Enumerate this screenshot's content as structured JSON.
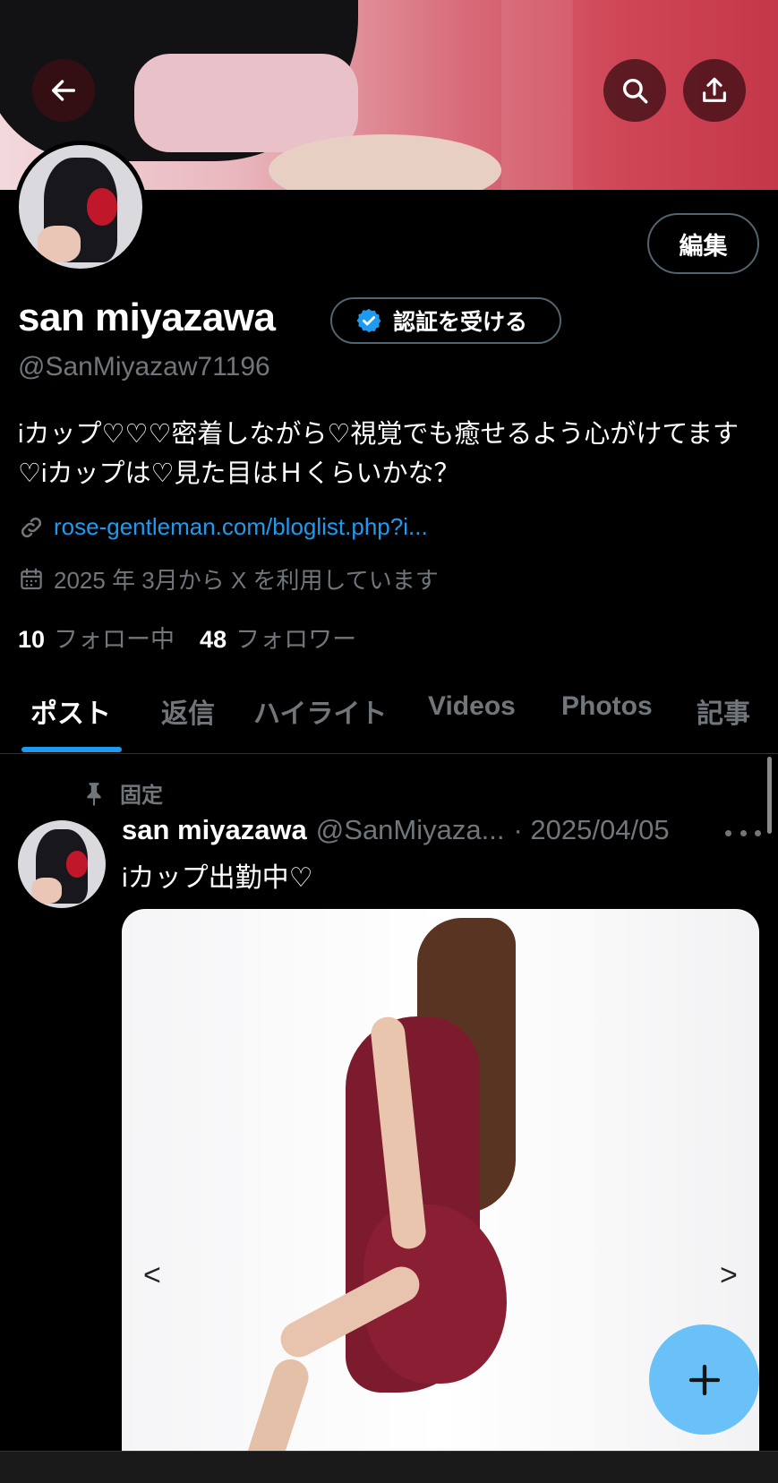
{
  "profile": {
    "name": "san miyazawa",
    "handle": "@SanMiyazaw71196",
    "bio": "iカップ♡♡♡密着しながら♡視覚でも癒せるよう心がけてます♡iカップは♡見た目はＨくらいかな？",
    "link": "rose-gentleman.com/bloglist.php?i...",
    "joined": "2025 年 3月から X を利用しています",
    "following_count": "10",
    "following_label": "フォロー中",
    "followers_count": "48",
    "followers_label": "フォロワー"
  },
  "buttons": {
    "edit": "編集",
    "verify": "認証を受ける"
  },
  "tabs": [
    {
      "label": "ポスト"
    },
    {
      "label": "返信"
    },
    {
      "label": "ハイライト"
    },
    {
      "label": "Videos"
    },
    {
      "label": "Photos"
    },
    {
      "label": "記事"
    }
  ],
  "active_tab": "ポスト",
  "pinned_post": {
    "pinned_label": "固定",
    "author_name": "san miyazawa",
    "author_handle": "@SanMiyaza...",
    "date": "· 2025/04/05",
    "text": "iカップ出勤中♡",
    "media_prev": "<",
    "media_next": ">"
  },
  "colors": {
    "accent": "#1d9bf0",
    "fab": "#69c1f8",
    "muted": "#71767b",
    "border": "#536471",
    "background": "#000000"
  },
  "icons": [
    "back-arrow-icon",
    "search-icon",
    "share-icon",
    "verified-badge-icon",
    "link-icon",
    "calendar-icon",
    "pin-icon",
    "more-icon",
    "plus-icon"
  ]
}
